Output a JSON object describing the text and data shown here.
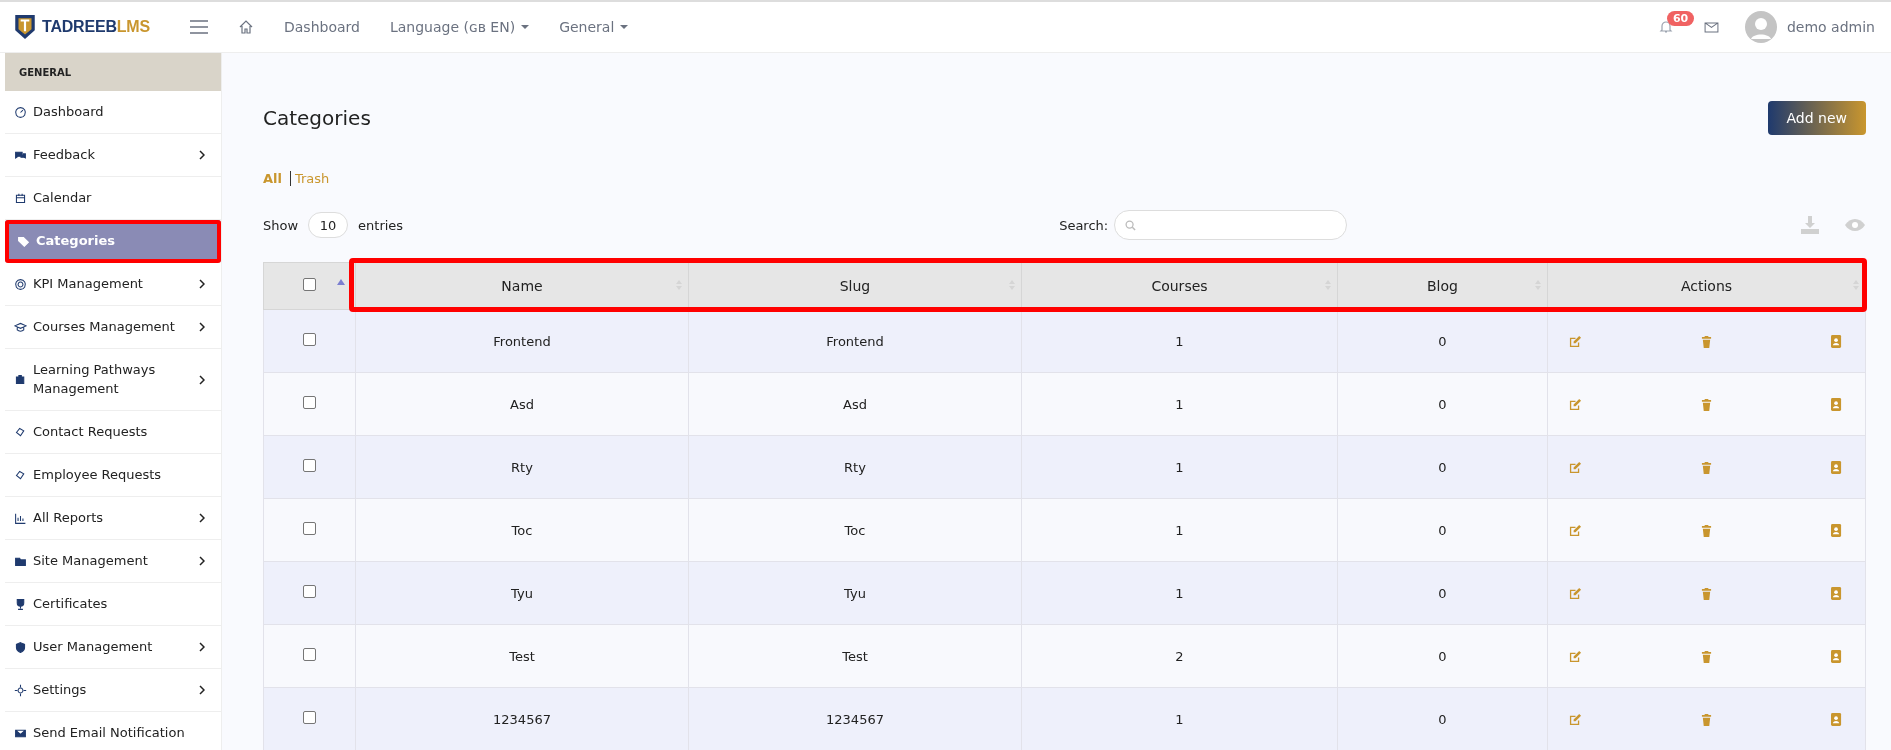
{
  "topbar": {
    "logo_primary": "TADREEB",
    "logo_accent": "LMS",
    "nav": [
      {
        "label": "Dashboard",
        "dropdown": false
      },
      {
        "label": "Language (ɢʙ EN)",
        "dropdown": true
      },
      {
        "label": "General",
        "dropdown": true
      }
    ],
    "notification_count": "60",
    "user_name": "demo admin"
  },
  "sidebar": {
    "section": "GENERAL",
    "items": [
      {
        "label": "Dashboard",
        "has_children": false,
        "selected": false,
        "highlighted": false
      },
      {
        "label": "Feedback",
        "has_children": true,
        "selected": false,
        "highlighted": false
      },
      {
        "label": "Calendar",
        "has_children": false,
        "selected": false,
        "highlighted": false
      },
      {
        "label": "Categories",
        "has_children": false,
        "selected": true,
        "highlighted": true
      },
      {
        "label": "KPI Management",
        "has_children": true,
        "selected": false,
        "highlighted": false
      },
      {
        "label": "Courses Management",
        "has_children": true,
        "selected": false,
        "highlighted": false
      },
      {
        "label": "Learning Pathways Management",
        "has_children": true,
        "selected": false,
        "highlighted": false
      },
      {
        "label": "Contact Requests",
        "has_children": false,
        "selected": false,
        "highlighted": false
      },
      {
        "label": "Employee Requests",
        "has_children": false,
        "selected": false,
        "highlighted": false
      },
      {
        "label": "All Reports",
        "has_children": true,
        "selected": false,
        "highlighted": false
      },
      {
        "label": "Site Management",
        "has_children": true,
        "selected": false,
        "highlighted": false
      },
      {
        "label": "Certificates",
        "has_children": false,
        "selected": false,
        "highlighted": false
      },
      {
        "label": "User Management",
        "has_children": true,
        "selected": false,
        "highlighted": false
      },
      {
        "label": "Settings",
        "has_children": true,
        "selected": false,
        "highlighted": false
      },
      {
        "label": "Send Email Notification",
        "has_children": false,
        "selected": false,
        "highlighted": false
      }
    ]
  },
  "page": {
    "title": "Categories",
    "add_button": "Add new",
    "filters": [
      {
        "label": "All",
        "selected": true
      },
      {
        "label": "Trash",
        "selected": false
      }
    ],
    "show_label": "Show",
    "entries_value": "10",
    "entries_label": "entries",
    "search_label": "Search:"
  },
  "table": {
    "header_highlighted": true,
    "select_all_checked": false,
    "columns": [
      "Name",
      "Slug",
      "Courses",
      "Blog",
      "Actions"
    ],
    "rows": [
      {
        "checked": false,
        "name": "Frontend",
        "slug": "Frontend",
        "courses": "1",
        "blog": "0"
      },
      {
        "checked": false,
        "name": "Asd",
        "slug": "Asd",
        "courses": "1",
        "blog": "0"
      },
      {
        "checked": false,
        "name": "Rty",
        "slug": "Rty",
        "courses": "1",
        "blog": "0"
      },
      {
        "checked": false,
        "name": "Toc",
        "slug": "Toc",
        "courses": "1",
        "blog": "0"
      },
      {
        "checked": false,
        "name": "Tyu",
        "slug": "Tyu",
        "courses": "1",
        "blog": "0"
      },
      {
        "checked": false,
        "name": "Test",
        "slug": "Test",
        "courses": "2",
        "blog": "0"
      },
      {
        "checked": false,
        "name": "1234567",
        "slug": "1234567",
        "courses": "1",
        "blog": "0"
      }
    ]
  }
}
